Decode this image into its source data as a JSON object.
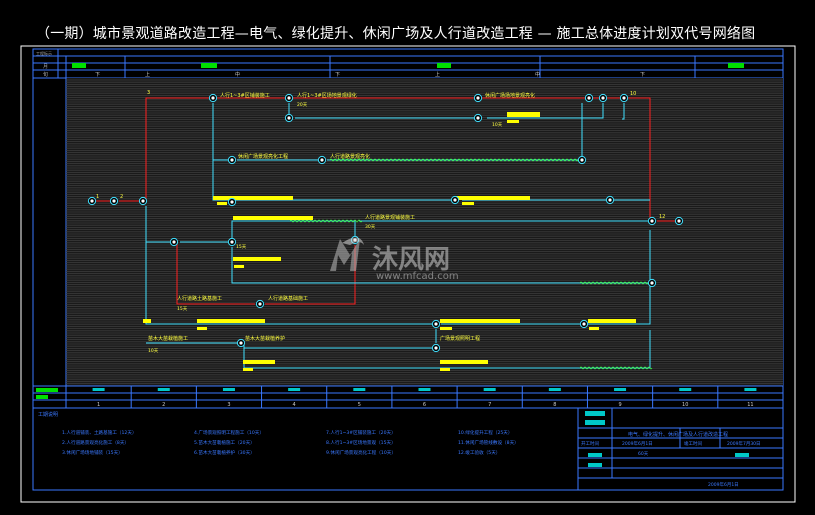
{
  "title": "（一期）城市景观道路改造工程—电气、绿化提升、休闲广场及人行道改造工程 — 施工总体进度计划双代号网络图",
  "header": {
    "row_labels": [
      "工程标示",
      "月",
      "旬"
    ],
    "xun_labels": [
      "下",
      "上",
      "中",
      "下",
      "上",
      "中",
      "下"
    ]
  },
  "nodes": [
    {
      "id": "1",
      "label": "1"
    },
    {
      "id": "2",
      "label": "2"
    },
    {
      "id": "3",
      "label": "3"
    },
    {
      "id": "10",
      "label": "10"
    },
    {
      "id": "12",
      "label": "12"
    }
  ],
  "activities": [
    {
      "key": "a1",
      "text": "人行1~3#区铺装施工"
    },
    {
      "key": "a2",
      "text": "人行1~3#区场地景观绿化"
    },
    {
      "key": "a3",
      "text": "休闲广场景观亮化工程"
    },
    {
      "key": "a4",
      "text": "休闲广场场地景观亮化"
    },
    {
      "key": "a5",
      "text": "人行道路基础施工"
    },
    {
      "key": "a6",
      "text": "人行道路土路基施工"
    },
    {
      "key": "a7",
      "text": "人行道路景观铺装施工"
    },
    {
      "key": "a8",
      "text": "苗木大苗栽植施工"
    },
    {
      "key": "a9",
      "text": "苗木大苗栽植养护"
    },
    {
      "key": "a10",
      "text": "广场景观照明工程"
    },
    {
      "key": "a11",
      "text": "人行道路景观亮化"
    }
  ],
  "durations": {
    "d1": "20天",
    "d2": "10天",
    "d3": "30天",
    "d4": "15天",
    "d5": "10天",
    "d6": "15天"
  },
  "bottom_scale": [
    "1",
    "2",
    "3",
    "4",
    "5",
    "6",
    "7",
    "8",
    "9",
    "10",
    "11"
  ],
  "legend": {
    "heading": "工期说明",
    "items": [
      "1.人行道铺装、土路基施工（12天）",
      "2.人行道路景观亮化施工（8天）",
      "3.休闲广场场地铺装（15天）",
      "4.广场景观照明工程施工（10天）",
      "5.苗木大苗栽植施工（20天）",
      "6.苗木大苗栽植养护（30天）",
      "7.人行1~3#区铺装施工（20天）",
      "8.人行1~3#区场地景观（15天）",
      "9.休闲广场景观亮化工程（10天）",
      "10.绿化提升工程（25天）",
      "11.休闲广场管线敷设（8天）",
      "12.竣工验收（5天）"
    ]
  },
  "title_block": {
    "project": "电气、绿化提升、休闲广场及人行道改造工程",
    "start_label": "开工时间",
    "start_date": "2009年6月1日",
    "end_label": "竣工时间",
    "end_date": "2009年7月30日",
    "duration": "60天",
    "date": "2009年6月1日"
  },
  "watermark": {
    "brand": "沐风网",
    "url": "www.mfcad.com"
  },
  "colors": {
    "background": "#000000",
    "frame": "#3a78ff",
    "grid_fill": "#2a2a2a",
    "critical_path": "#ff2020",
    "normal_path": "#40e0ff",
    "label": "#ffff40",
    "bar": "#ffff00",
    "green_cell": "#00e000",
    "cyan_cell": "#00c8c8",
    "wavy": "#40ff40"
  }
}
